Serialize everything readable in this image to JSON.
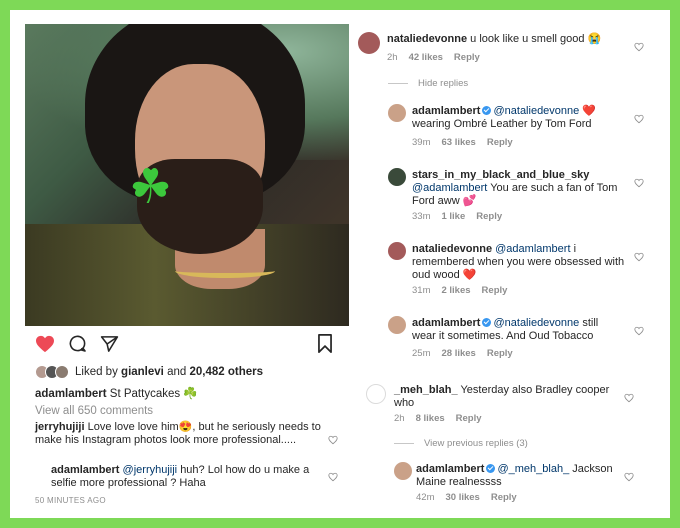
{
  "post": {
    "liked_by_prefix": "Liked by",
    "liked_by_user": "gianlevi",
    "liked_by_suffix": "and",
    "likes_count": "20,482 others",
    "caption_user": "adamlambert",
    "caption_text": "St Pattycakes",
    "caption_emoji": "☘️",
    "view_all": "View all 650 comments",
    "time_ago": "50 MINUTES AGO"
  },
  "left_comments": [
    {
      "user": "jerryhujiji",
      "text": "Love love love him😍, but he seriously needs to make his Instagram photos look more professional....."
    },
    {
      "user": "adamlambert",
      "mention": "@jerryhujiji",
      "text": "huh? Lol how do u make a selfie more professional ? Haha"
    }
  ],
  "right_comments": [
    {
      "user": "nataliedevonne",
      "text": "u look like u smell good 😭",
      "time": "2h",
      "likes": "42 likes",
      "reply": "Reply"
    },
    {
      "user": "adamlambert",
      "mention": "@nataliedevonne",
      "text_inline": "❤️",
      "text": "wearing Ombré Leather by Tom Ford",
      "time": "39m",
      "likes": "63 likes",
      "reply": "Reply"
    },
    {
      "user": "stars_in_my_black_and_blue_sky",
      "mention": "@adamlambert",
      "text": "You are such a fan of Tom Ford aww 💕",
      "time": "33m",
      "likes": "1 like",
      "reply": "Reply"
    },
    {
      "user": "nataliedevonne",
      "mention": "@adamlambert",
      "text_inline": "i",
      "text": "remembered when you were obsessed with oud wood ❤️",
      "time": "31m",
      "likes": "2 likes",
      "reply": "Reply"
    },
    {
      "user": "adamlambert",
      "mention": "@nataliedevonne",
      "text_inline": "still",
      "text": "wear it sometimes. And Oud Tobacco",
      "time": "25m",
      "likes": "28 likes",
      "reply": "Reply"
    },
    {
      "user": "_meh_blah_",
      "text": "Yesterday also Bradley cooper who",
      "time": "2h",
      "likes": "8 likes",
      "reply": "Reply"
    },
    {
      "user": "adamlambert",
      "mention": "@_meh_blah_",
      "text_inline": "Jackson",
      "text": "Maine realnessss",
      "time": "42m",
      "likes": "30 likes",
      "reply": "Reply"
    }
  ],
  "hide_replies": "Hide replies",
  "view_previous": "View previous replies (3)",
  "colors": {
    "frame": "#7ed957",
    "like_red": "#ed4956",
    "link": "#00376b",
    "verified": "#3897f0"
  }
}
